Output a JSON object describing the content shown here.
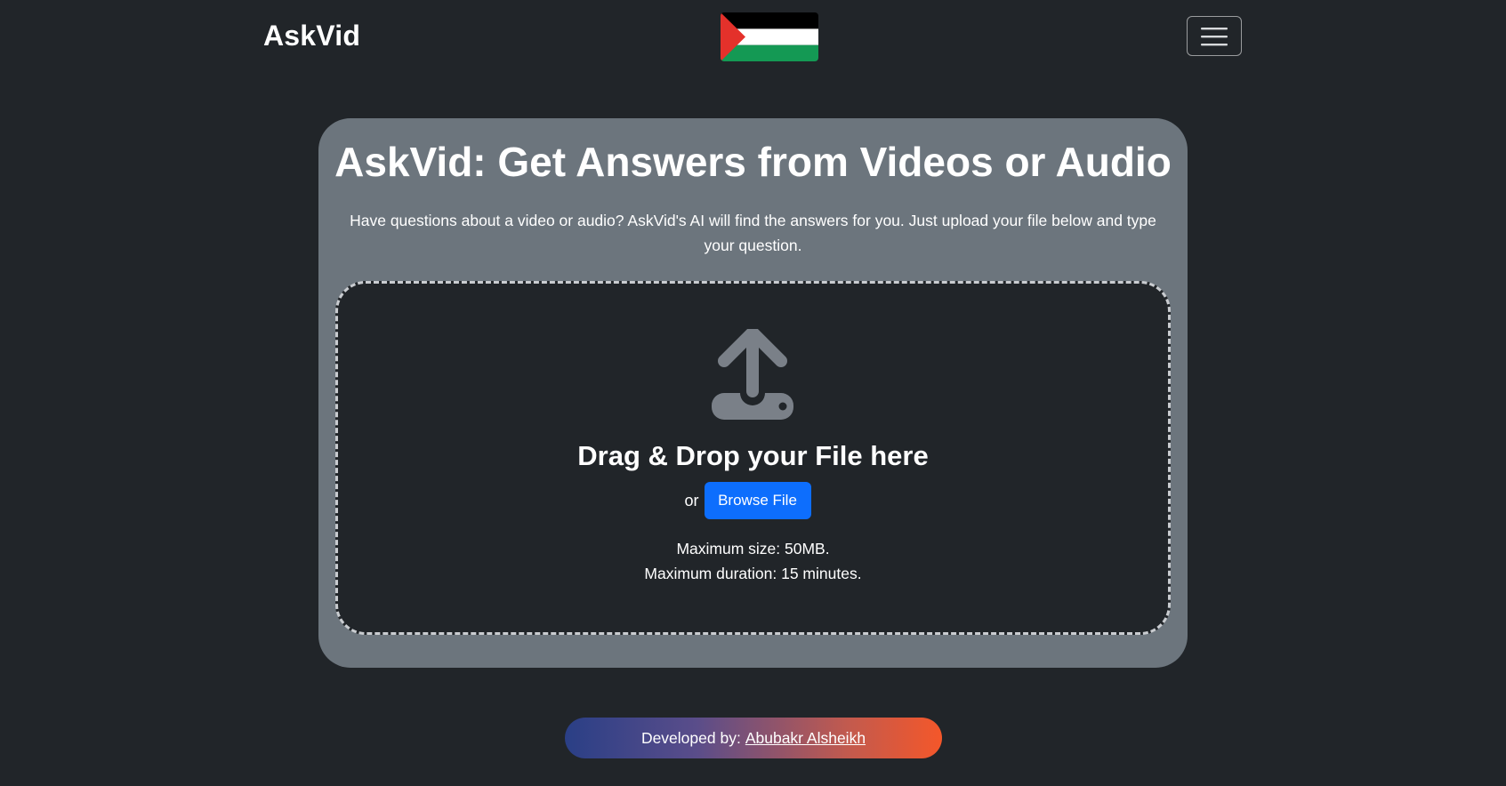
{
  "navbar": {
    "brand": "AskVid",
    "flag_icon": "palestine-flag-icon",
    "menu_icon": "hamburger-menu-icon"
  },
  "hero": {
    "title": "AskVid: Get Answers from Videos or Audio",
    "description": "Have questions about a video or audio? AskVid's AI will find the answers for you. Just upload your file below and type your question."
  },
  "dropzone": {
    "icon": "upload-icon",
    "title": "Drag & Drop your File here",
    "or_text": "or",
    "browse_label": "Browse File",
    "max_size": "Maximum size: 50MB.",
    "max_duration": "Maximum duration: 15 minutes."
  },
  "footer": {
    "prefix": "Developed by:",
    "author": "Abubakr Alsheikh"
  },
  "colors": {
    "background": "#212529",
    "card": "#6c757d",
    "primary_button": "#0d6efd",
    "footer_gradient_start": "#2a3f86",
    "footer_gradient_end": "#f4572a",
    "flag_black": "#000000",
    "flag_white": "#ffffff",
    "flag_green": "#149954",
    "flag_red": "#e4312b"
  }
}
